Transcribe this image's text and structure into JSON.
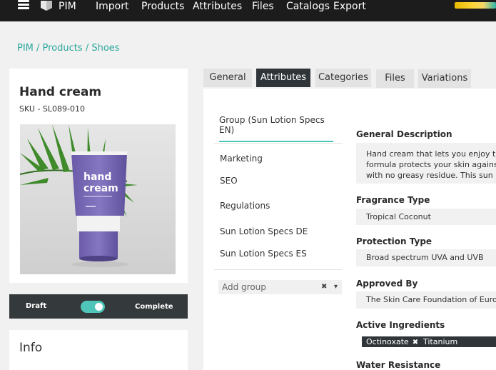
{
  "topbar": {
    "brand": "PIM",
    "nav": [
      "Import",
      "Products",
      "Attributes",
      "Files",
      "Catalogs",
      "Export"
    ]
  },
  "breadcrumb": [
    "PIM",
    "Products",
    "Shoes"
  ],
  "product": {
    "title": "Hand cream",
    "sku": "SKU -  SL089-010",
    "image_text": [
      "hand",
      "cream"
    ]
  },
  "status": {
    "left_label": "Draft",
    "right_label": "Complete",
    "is_complete": true
  },
  "info": {
    "title": "Info"
  },
  "tabs": [
    {
      "label": "General",
      "active": false
    },
    {
      "label": "Attributes",
      "active": true
    },
    {
      "label": "Categories",
      "active": false
    },
    {
      "label": "Files",
      "active": false
    },
    {
      "label": "Variations",
      "active": false
    }
  ],
  "groups": {
    "active": "Group (Sun Lotion Specs EN)",
    "items": [
      "Marketing",
      "SEO",
      "Regulations",
      "Sun Lotion Specs DE",
      "Sun Lotion Specs ES"
    ],
    "add_placeholder": "Add group",
    "add_clear": "✖",
    "add_caret": "▾"
  },
  "fields": {
    "general_description": {
      "label": "General Description",
      "lines": [
        "Hand cream that lets you enjoy the be",
        "formula protects your skin against th",
        "with no greasy residue. This sun lotio"
      ]
    },
    "fragrance_type": {
      "label": "Fragrance Type",
      "value": "Tropical Coconut"
    },
    "protection_type": {
      "label": "Protection Type",
      "value": "Broad spectrum UVA and UVB"
    },
    "approved_by": {
      "label": "Approved By",
      "value": "The Skin Care Foundation of Europe"
    },
    "active_ingredients": {
      "label": "Active Ingredients",
      "tags": [
        "Octinoxate",
        "Titanium Dioxide"
      ],
      "remove_glyph": "✖"
    },
    "water_resistance": {
      "label": "Water Resistance"
    }
  },
  "colors": {
    "accent": "#4fc4b8",
    "link": "#2aa79b",
    "dark": "#2f3538",
    "topbar": "#1c1c1c",
    "tube": "#7c6cb3"
  }
}
